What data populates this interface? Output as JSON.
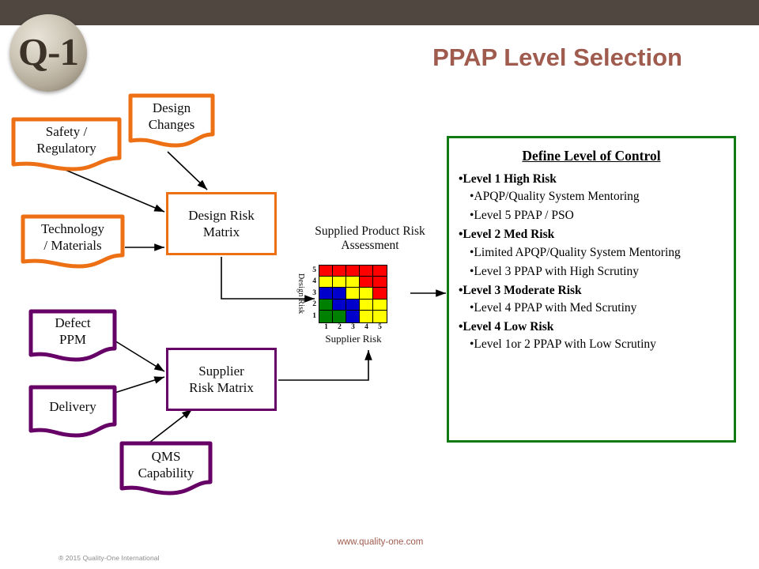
{
  "header": {
    "logo_text": "Q-1",
    "title": "PPAP Level Selection"
  },
  "inputs": {
    "safety": "Safety /\nRegulatory",
    "design_changes": "Design\nChanges",
    "technology": "Technology\n/ Materials",
    "defect_ppm": "Defect\nPPM",
    "delivery": "Delivery",
    "qms": "QMS\nCapability"
  },
  "process": {
    "design_risk_matrix": "Design Risk\nMatrix",
    "supplier_risk_matrix": "Supplier\nRisk Matrix"
  },
  "chart_data": {
    "type": "heatmap",
    "title": "Supplied Product Risk Assessment",
    "xlabel": "Supplier Risk",
    "ylabel": "Design Risk",
    "x_ticks": [
      "1",
      "2",
      "3",
      "4",
      "5"
    ],
    "y_ticks": [
      "5",
      "4",
      "3",
      "2",
      "1"
    ],
    "xlim": [
      1,
      5
    ],
    "ylim": [
      1,
      5
    ],
    "grid": true,
    "legend": "none",
    "color_map": {
      "green": "#008000",
      "blue": "#0000CC",
      "yellow": "#FFFF00",
      "red": "#FF0000"
    },
    "rows": [
      {
        "design_risk": 5,
        "cells": [
          "red",
          "red",
          "red",
          "red",
          "red"
        ]
      },
      {
        "design_risk": 4,
        "cells": [
          "yellow",
          "yellow",
          "yellow",
          "red",
          "red"
        ]
      },
      {
        "design_risk": 3,
        "cells": [
          "blue",
          "blue",
          "yellow",
          "yellow",
          "red"
        ]
      },
      {
        "design_risk": 2,
        "cells": [
          "green",
          "blue",
          "blue",
          "yellow",
          "yellow"
        ]
      },
      {
        "design_risk": 1,
        "cells": [
          "green",
          "green",
          "blue",
          "yellow",
          "yellow"
        ]
      }
    ]
  },
  "control_panel": {
    "title": "Define Level of Control",
    "items": [
      {
        "level": 1,
        "label": "Level 1 High Risk",
        "subs": [
          "APQP/Quality System Mentoring",
          "Level 5 PPAP / PSO"
        ]
      },
      {
        "level": 2,
        "label": "Level 2 Med Risk",
        "subs": [
          "Limited APQP/Quality System Mentoring",
          "Level 3 PPAP with High Scrutiny"
        ]
      },
      {
        "level": 3,
        "label": "Level 3 Moderate Risk",
        "subs": [
          "Level 4 PPAP with Med Scrutiny"
        ]
      },
      {
        "level": 4,
        "label": "Level 4  Low Risk",
        "subs": [
          "Level 1or 2 PPAP with Low Scrutiny"
        ]
      }
    ]
  },
  "footer": {
    "url": "www.quality-one.com",
    "copyright": "® 2015 Quality-One International"
  },
  "colors": {
    "header_bar": "#4F4740",
    "title": "#9E5B4E",
    "orange": "#ED7014",
    "purple": "#660066",
    "green": "#127A12"
  }
}
